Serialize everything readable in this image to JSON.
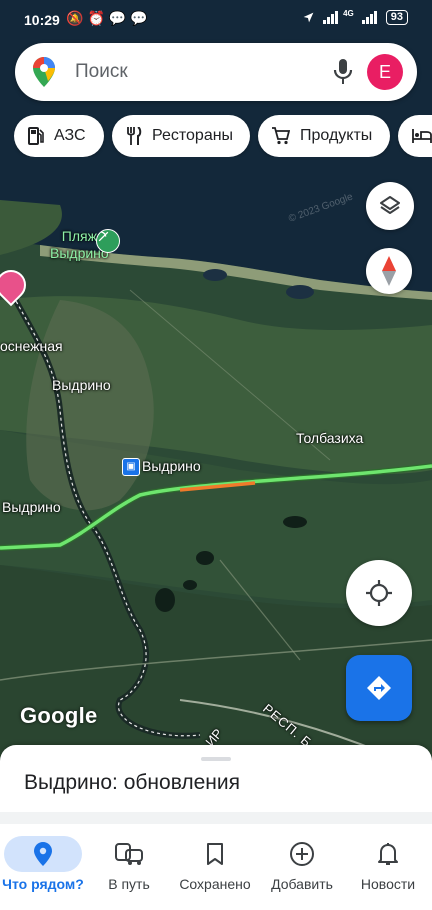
{
  "status_bar": {
    "time": "10:29",
    "battery": "93",
    "network": "4G"
  },
  "search": {
    "placeholder": "Поиск",
    "avatar_letter": "E"
  },
  "chips": [
    {
      "label": "АЗС",
      "icon": "gas-station-icon"
    },
    {
      "label": "Рестораны",
      "icon": "restaurant-icon"
    },
    {
      "label": "Продукты",
      "icon": "cart-icon"
    },
    {
      "label": "",
      "icon": "hotel-icon"
    }
  ],
  "map": {
    "labels": {
      "beach": "Пляж\nВыдрино",
      "snezhnaya": "оснежная",
      "vydrino_1": "Выдрино",
      "tolbazikha": "Толбазиха",
      "station": "Выдрино",
      "vydrino_2": "Выдрино",
      "road": "РЕСП. Б",
      "road2": "ИР"
    },
    "logo": "Google",
    "watermark": "© 2023 Google"
  },
  "sheet": {
    "title": "Выдрино: обновления"
  },
  "bottom_nav": [
    {
      "label": "Что рядом?",
      "icon": "location-pin-icon",
      "active": true
    },
    {
      "label": "В путь",
      "icon": "commute-icon",
      "active": false
    },
    {
      "label": "Сохранено",
      "icon": "bookmark-icon",
      "active": false
    },
    {
      "label": "Добавить",
      "icon": "add-circle-icon",
      "active": false
    },
    {
      "label": "Новости",
      "icon": "bell-icon",
      "active": false
    }
  ],
  "colors": {
    "accent": "#1a73e8",
    "avatar": "#e91e63",
    "route": "#6ee56e"
  }
}
